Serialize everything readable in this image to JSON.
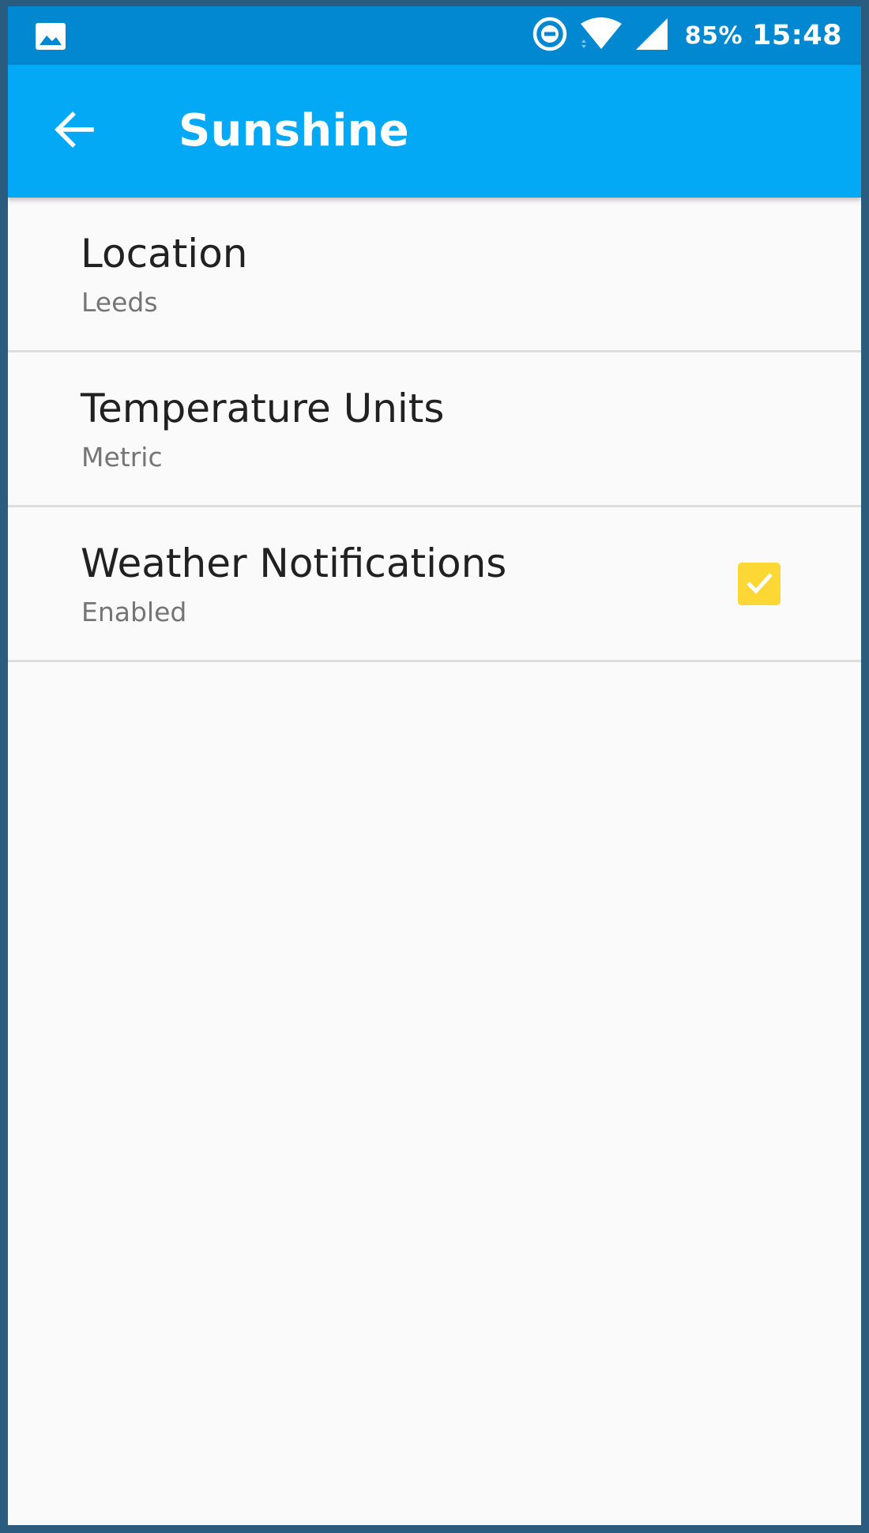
{
  "status_bar": {
    "left_icon": "image-icon",
    "battery_percent": "85%",
    "time": "15:48",
    "icons": [
      "do-not-disturb-icon",
      "wifi-icon",
      "cellular-signal-icon"
    ]
  },
  "app_bar": {
    "back_icon": "arrow-back-icon",
    "title": "Sunshine",
    "color": "#03a9f4"
  },
  "preferences": [
    {
      "title": "Location",
      "summary": "Leeds"
    },
    {
      "title": "Temperature Units",
      "summary": "Metric"
    },
    {
      "title": "Weather Notifications",
      "summary": "Enabled",
      "checked": true,
      "checkbox_color": "#fdd835"
    }
  ]
}
